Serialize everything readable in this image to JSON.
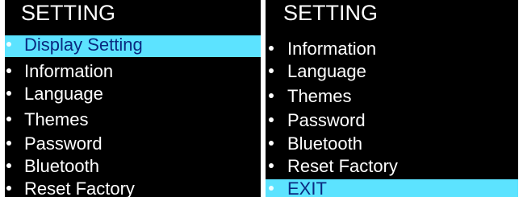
{
  "left_screen": {
    "title": "SETTING",
    "items": [
      {
        "label": "Display Setting",
        "selected": true
      },
      {
        "label": "Information",
        "selected": false
      },
      {
        "label": "Language",
        "selected": false
      },
      {
        "label": "Themes",
        "selected": false
      },
      {
        "label": "Password",
        "selected": false
      },
      {
        "label": "Bluetooth",
        "selected": false
      },
      {
        "label": "Reset Factory",
        "selected": false
      }
    ]
  },
  "right_screen": {
    "title": "SETTING",
    "items": [
      {
        "label": "Information",
        "selected": false
      },
      {
        "label": "Language",
        "selected": false
      },
      {
        "label": "Themes",
        "selected": false
      },
      {
        "label": "Password",
        "selected": false
      },
      {
        "label": "Bluetooth",
        "selected": false
      },
      {
        "label": "Reset Factory",
        "selected": false
      },
      {
        "label": "EXIT",
        "selected": true
      }
    ]
  },
  "colors": {
    "screen_background": "#000000",
    "highlight": "#5ce3ff",
    "highlight_text": "#0a2a80",
    "text": "#ffffff"
  }
}
